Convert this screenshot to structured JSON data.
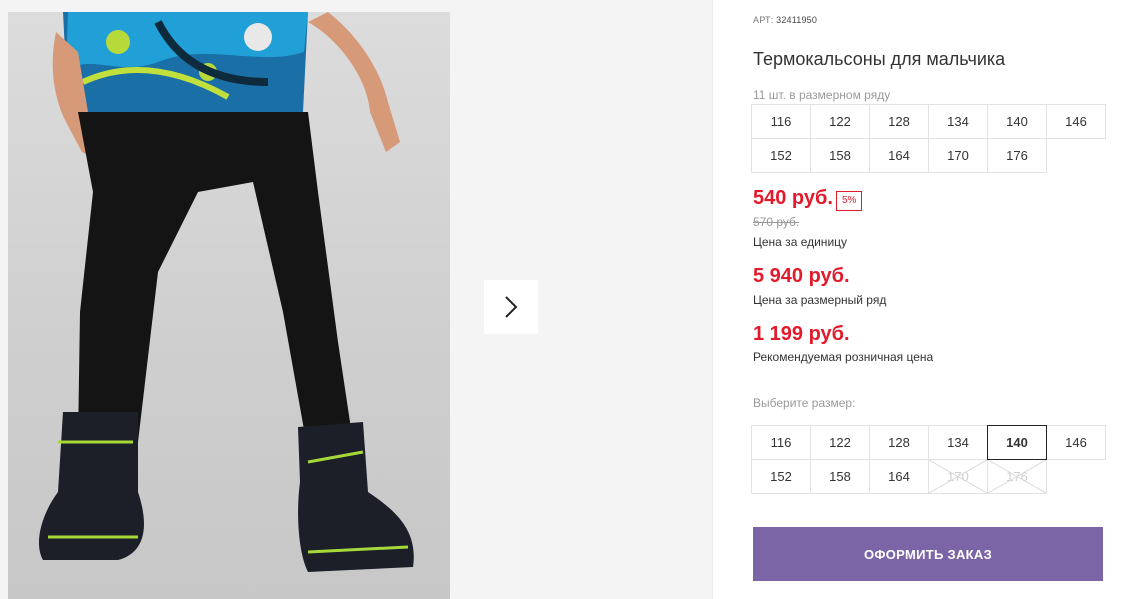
{
  "gallery": {
    "next_icon": "chevron-right-icon"
  },
  "product": {
    "art_label": "АРТ:",
    "art_value": "32411950",
    "title": "Термокальсоны для мальчика",
    "pack_note": "11 шт. в размерном ряду",
    "pack_sizes": [
      "116",
      "122",
      "128",
      "134",
      "140",
      "146",
      "152",
      "158",
      "164",
      "170",
      "176"
    ],
    "price_unit": "540 руб.",
    "discount": "5%",
    "old_price": "570 руб.",
    "price_unit_caption": "Цена за единицу",
    "price_pack": "5 940 руб.",
    "price_pack_caption": "Цена за размерный ряд",
    "price_retail": "1 199 руб.",
    "price_retail_caption": "Рекомендуемая розничная цена",
    "choose_label": "Выберите размер:",
    "choose_sizes": [
      {
        "label": "116",
        "state": "available"
      },
      {
        "label": "122",
        "state": "available"
      },
      {
        "label": "128",
        "state": "available"
      },
      {
        "label": "134",
        "state": "available"
      },
      {
        "label": "140",
        "state": "selected"
      },
      {
        "label": "146",
        "state": "available"
      },
      {
        "label": "152",
        "state": "available"
      },
      {
        "label": "158",
        "state": "available"
      },
      {
        "label": "164",
        "state": "available"
      },
      {
        "label": "170",
        "state": "disabled"
      },
      {
        "label": "176",
        "state": "disabled"
      }
    ],
    "order_button": "ОФОРМИТЬ ЗАКАЗ"
  },
  "colors": {
    "price_red": "#e21b2c",
    "order_button": "#7b65a6"
  }
}
